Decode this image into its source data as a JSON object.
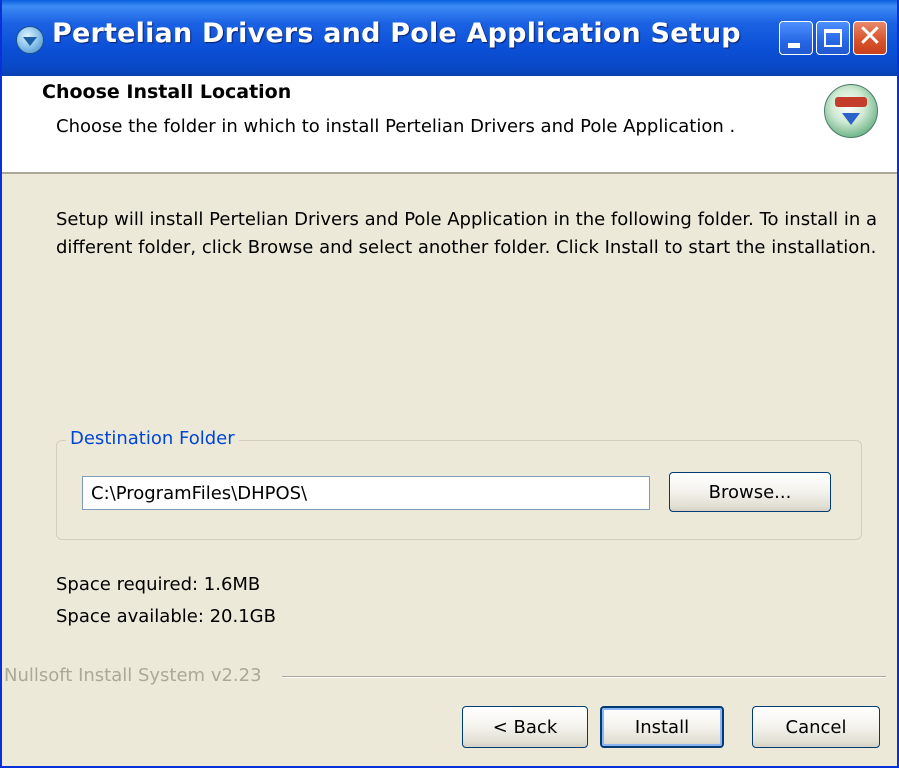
{
  "window": {
    "title": "Pertelian Drivers and Pole Application  Setup",
    "controls": {
      "minimize": "minimize-icon",
      "maximize": "maximize-icon",
      "close": "close-icon",
      "close_glyph": "✕"
    }
  },
  "header": {
    "title": "Choose Install Location",
    "subtitle": "Choose the folder in which to install Pertelian Drivers and Pole Application ."
  },
  "body": {
    "description_lines": [
      "Setup will install Pertelian Drivers and Pole Application  in the following folder. To install in a",
      "different folder, click Browse and select another folder. Click Install to start the installation."
    ],
    "destination": {
      "group_label": "Destination Folder",
      "path_value": "C:\\ProgramFiles\\DHPOS\\",
      "browse_label": "Browse..."
    },
    "space_required": "Space required: 1.6MB",
    "space_available": "Space available: 20.1GB"
  },
  "footer": {
    "branding": "Nullsoft Install System v2.23",
    "back_label": "< Back",
    "install_label": "Install",
    "cancel_label": "Cancel"
  },
  "colors": {
    "titlebar": "#0a4fd6",
    "face": "#ece9d8",
    "group_label": "#0046d5",
    "close_button": "#d9542c"
  }
}
